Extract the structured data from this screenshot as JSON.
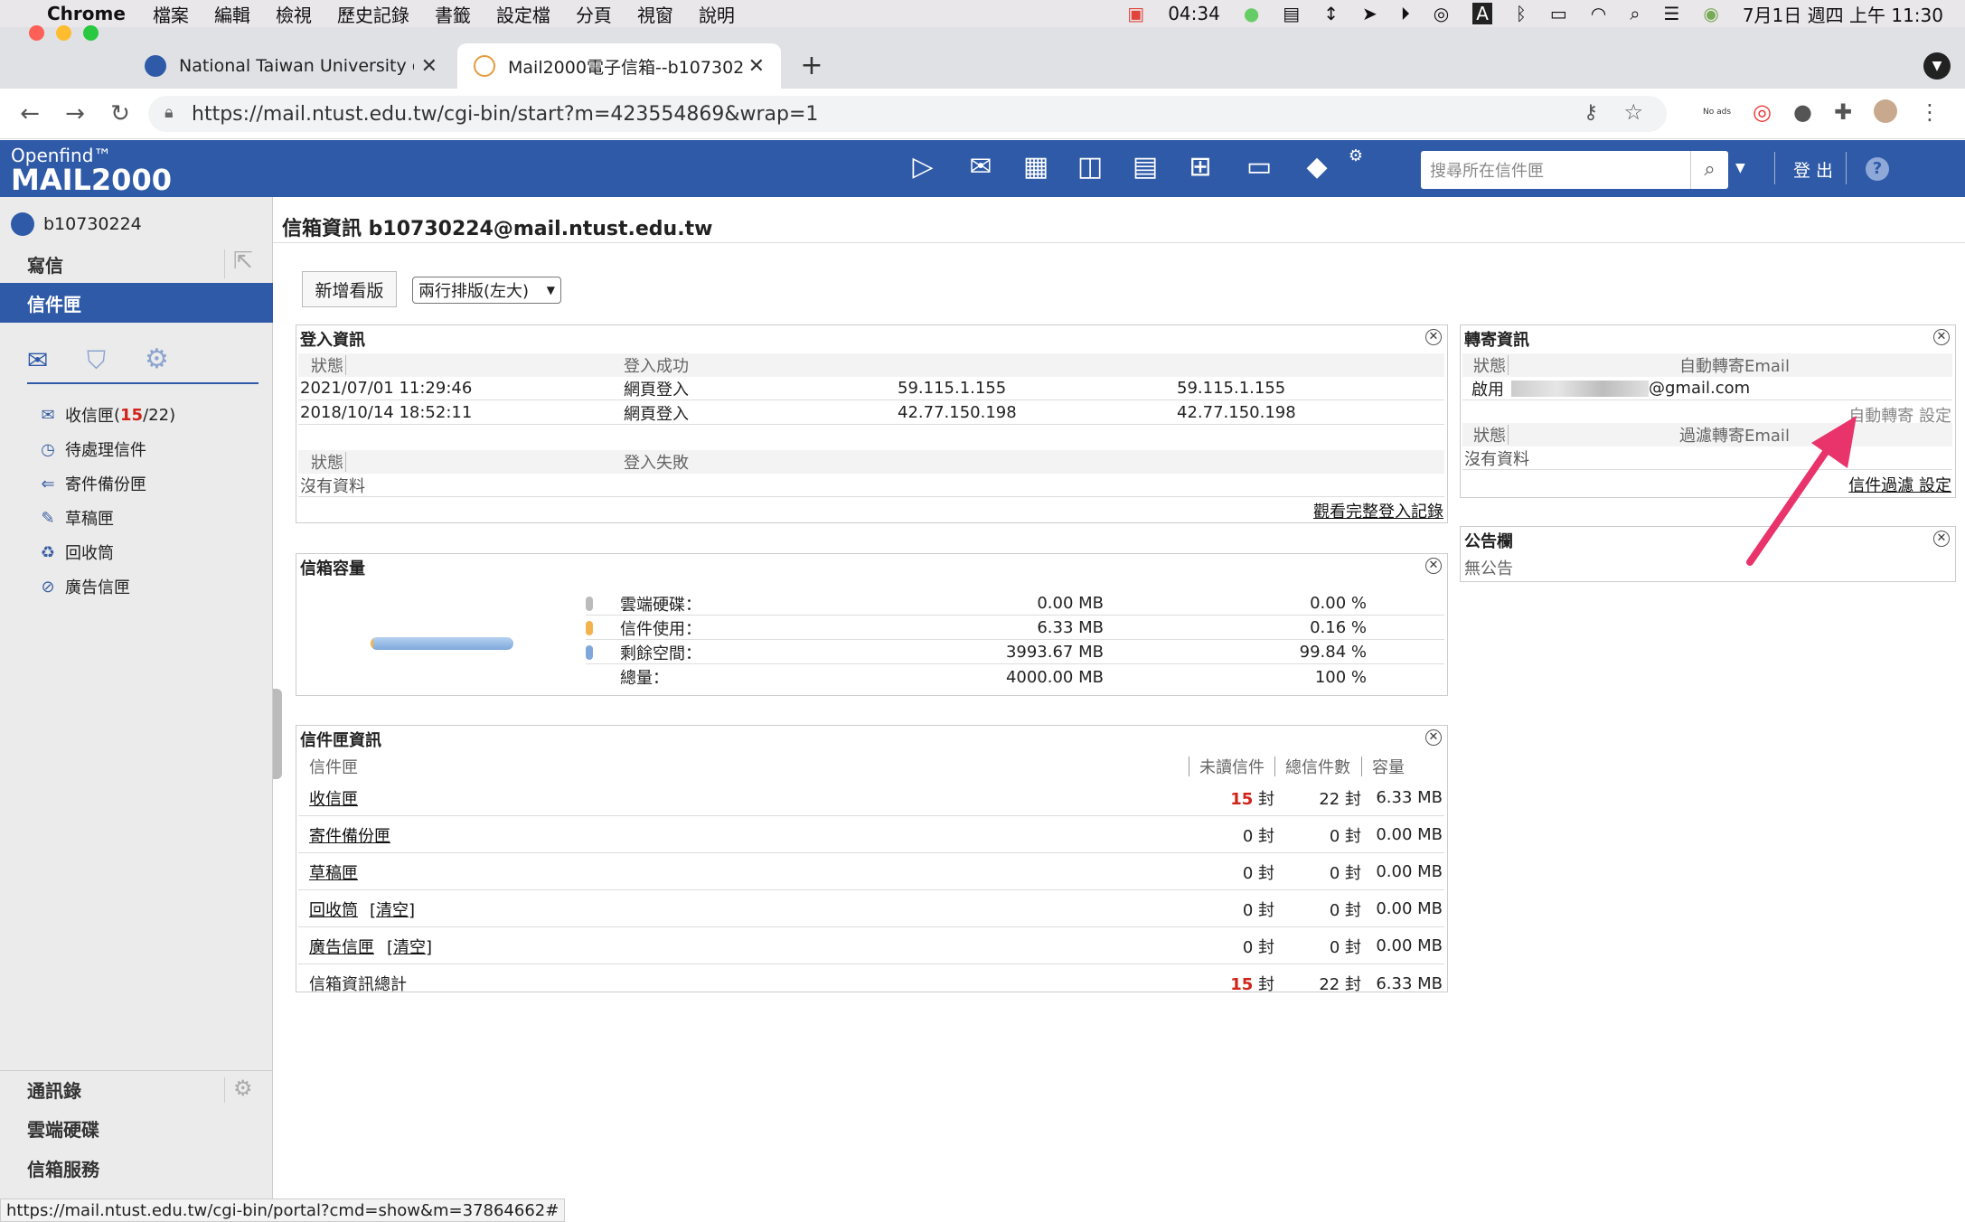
{
  "menubar": {
    "app": "Chrome",
    "items": [
      "檔案",
      "編輯",
      "檢視",
      "歷史記錄",
      "書籤",
      "設定檔",
      "分頁",
      "視窗",
      "說明"
    ],
    "timer": "04:34",
    "datetime": "7月1日 週四 上午 11:30"
  },
  "tabs": [
    {
      "title": "National Taiwan University of S"
    },
    {
      "title": "Mail2000電子信箱--b10730224"
    }
  ],
  "url": "https://mail.ntust.edu.tw/cgi-bin/start?m=423554869&wrap=1",
  "noads": "No ads",
  "logo": {
    "top": "Openfind™",
    "main": "MAIL2000"
  },
  "search": {
    "placeholder": "搜尋所在信件匣"
  },
  "header": {
    "logout": "登 出",
    "help": "?"
  },
  "user": "b10730224",
  "sidebar": {
    "compose": "寫信",
    "mailbox": "信件匣",
    "folders": [
      {
        "name": "收信匣",
        "unread": "15",
        "total": "/22)",
        "open": "("
      },
      {
        "name": "待處理信件"
      },
      {
        "name": "寄件備份匣"
      },
      {
        "name": "草稿匣"
      },
      {
        "name": "回收筒"
      },
      {
        "name": "廣告信匣"
      }
    ],
    "bottom": [
      "通訊錄",
      "雲端硬碟",
      "信箱服務"
    ]
  },
  "page": {
    "title": "信箱資訊 b10730224@mail.ntust.edu.tw",
    "new_board": "新增看版",
    "layout": "兩行排版(左大)"
  },
  "login": {
    "title": "登入資訊",
    "status": "狀態",
    "success": "登入成功",
    "rows": [
      {
        "time": "2021/07/01 11:29:46",
        "type": "網頁登入",
        "ip1": "59.115.1.155",
        "ip2": "59.115.1.155"
      },
      {
        "time": "2018/10/14 18:52:11",
        "type": "網頁登入",
        "ip1": "42.77.150.198",
        "ip2": "42.77.150.198"
      }
    ],
    "fail_status": "狀態",
    "fail": "登入失敗",
    "nodata": "沒有資料",
    "full_link": "觀看完整登入記錄"
  },
  "capacity": {
    "title": "信箱容量",
    "rows": [
      {
        "label": "雲端硬碟：",
        "mb": "0.00 MB",
        "pct": "0.00 %"
      },
      {
        "label": "信件使用：",
        "mb": "6.33 MB",
        "pct": "0.16 %"
      },
      {
        "label": "剩餘空間：",
        "mb": "3993.67 MB",
        "pct": "99.84 %"
      },
      {
        "label": "總量：",
        "mb": "4000.00 MB",
        "pct": "100 %"
      }
    ],
    "used_fraction": 0.0016
  },
  "mailbox_info": {
    "title": "信件匣資訊",
    "headers": [
      "信件匣",
      "未讀信件",
      "總信件數",
      "容量"
    ],
    "rows": [
      {
        "name": "收信匣",
        "clear": "",
        "unread": "15",
        "unread_unit": "封",
        "total": "22 封",
        "size": "6.33 MB"
      },
      {
        "name": "寄件備份匣",
        "clear": "",
        "unread": "0",
        "unread_unit": "封",
        "total": "0 封",
        "size": "0.00 MB"
      },
      {
        "name": "草稿匣",
        "clear": "",
        "unread": "0",
        "unread_unit": "封",
        "total": "0 封",
        "size": "0.00 MB"
      },
      {
        "name": "回收筒",
        "clear": "[清空]",
        "unread": "0",
        "unread_unit": "封",
        "total": "0 封",
        "size": "0.00 MB"
      },
      {
        "name": "廣告信匣",
        "clear": "[清空]",
        "unread": "0",
        "unread_unit": "封",
        "total": "0 封",
        "size": "0.00 MB"
      }
    ],
    "total_row": {
      "name": "信箱資訊總計",
      "unread": "15",
      "unread_unit": "封",
      "total": "22 封",
      "size": "6.33 MB"
    }
  },
  "forward": {
    "title": "轉寄資訊",
    "status": "狀態",
    "auto_email": "自動轉寄Email",
    "enabled": "啟用",
    "email": "@gmail.com",
    "auto_setting": "自動轉寄 設定",
    "filter_status": "狀態",
    "filter_email": "過濾轉寄Email",
    "nodata": "沒有資料",
    "filter_setting": "信件過濾 設定"
  },
  "board": {
    "title": "公告欄",
    "content": "無公告"
  },
  "statusbar": "https://mail.ntust.edu.tw/cgi-bin/portal?cmd=show&m=37864662#",
  "colors": {
    "brand": "#2f5aa8",
    "unread": "#d0241a",
    "arrow": "#e8336b"
  }
}
